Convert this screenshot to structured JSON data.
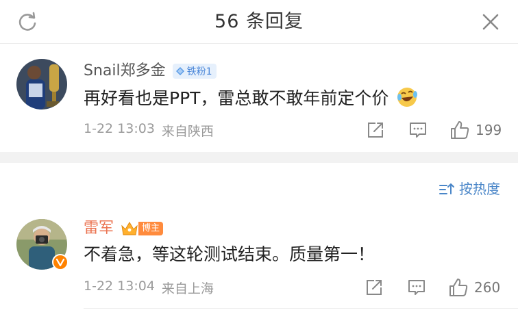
{
  "header": {
    "title": "56 条回复"
  },
  "comments": [
    {
      "username": "Snail郑多金",
      "badge": "铁粉1",
      "text": "再好看也是PPT，雷总敢不敢年前定个价",
      "emoji": "crying-laughing-emoji",
      "date": "1-22 13:03",
      "location": "来自陕西",
      "likes": "199"
    },
    {
      "username": "雷军",
      "badge": "博主",
      "text": "不着急，等这轮测试结束。质量第一！",
      "date": "1-22 13:04",
      "location": "来自上海",
      "likes": "260"
    }
  ],
  "sort": {
    "label": "按热度"
  },
  "colors": {
    "accent_blue": "#4a86c8",
    "host_name": "#eb7350",
    "host_badge": "#ff8b3d",
    "verified": "#ff8200",
    "divider": "#f2f2f2"
  }
}
